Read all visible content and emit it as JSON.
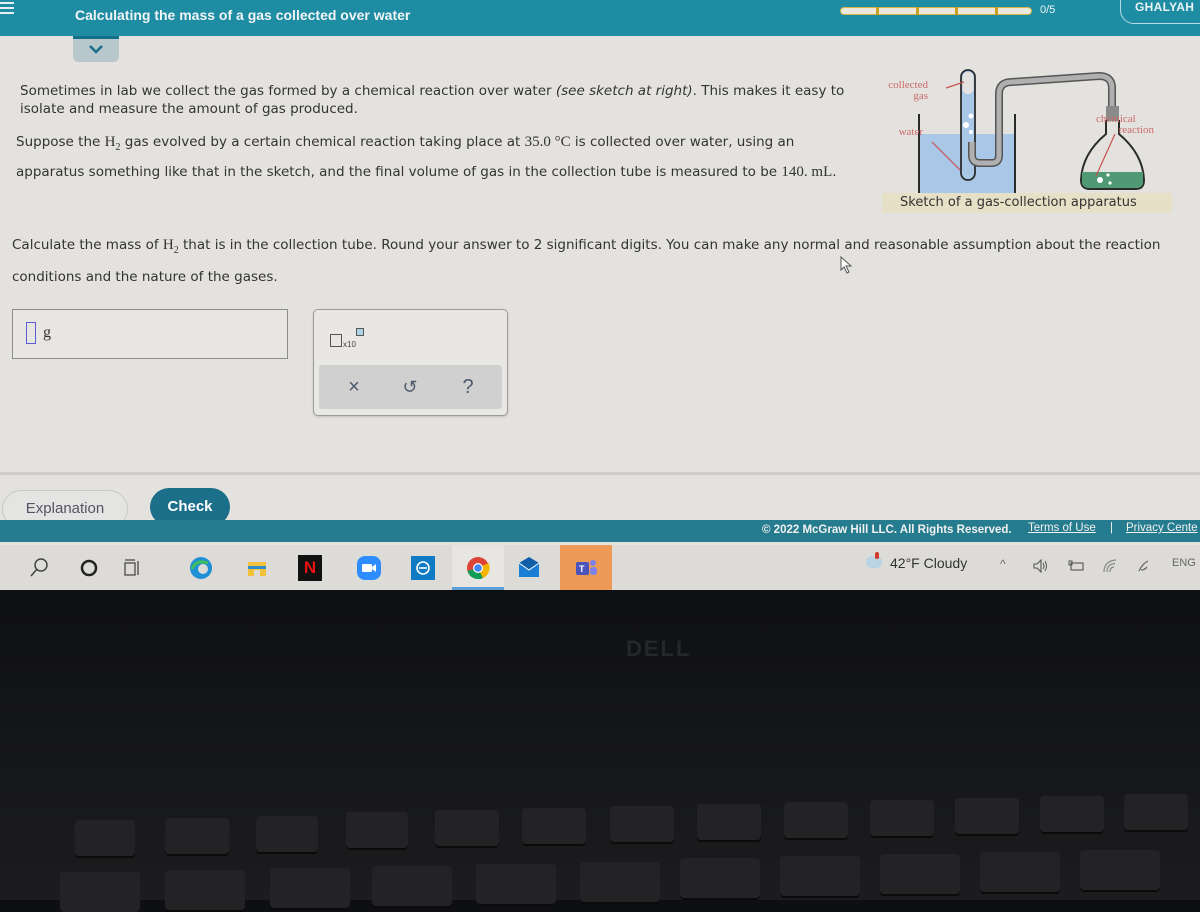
{
  "header": {
    "menu_icon": "hamburger-menu-icon",
    "title": "Calculating the mass of a gas collected over water",
    "progress": {
      "completed": 0,
      "total": 5,
      "label": "0/5"
    },
    "user_name": "GHALYAH",
    "collapse_icon": "chevron-down-icon"
  },
  "problem": {
    "p1_a": "Sometimes in lab we collect the gas formed by a chemical reaction over water ",
    "p1_italic": "(see sketch at right)",
    "p1_b": ". This makes it easy to isolate and measure the amount of gas produced.",
    "p2_a": "Suppose the ",
    "gas_symbol": "H",
    "gas_subscript": "2",
    "p2_b": " gas evolved by a certain chemical reaction taking place at ",
    "temperature": "35.0 °C",
    "p2_c": " is collected over water, using an apparatus something like that in the sketch, and the final volume of gas in the collection tube is measured to be ",
    "volume": "140. mL",
    "p2_d": ".",
    "p3_a": "Calculate the mass of ",
    "p3_b": " that is in the collection tube. Round your answer to 2 significant digits. You can make any normal and reasonable assumption about the reaction conditions and the nature of the gases."
  },
  "figure": {
    "labels": {
      "collected_gas": [
        "collected",
        "gas"
      ],
      "water": "water",
      "chemical_reaction": [
        "chemical",
        "reaction"
      ]
    },
    "caption": "Sketch of a gas-collection apparatus",
    "colors": {
      "water": "#a9c8e8",
      "reaction": "#4f9a74",
      "tube": "#a8a8a8",
      "label": "#c96a6a"
    }
  },
  "answer": {
    "value": "",
    "unit": "g"
  },
  "tools": {
    "sci_notation_label": "x10",
    "clear_icon": "×",
    "undo_icon": "↺",
    "help_icon": "?"
  },
  "buttons": {
    "explanation": "Explanation",
    "check": "Check"
  },
  "footer": {
    "copyright": "© 2022 McGraw Hill LLC. All Rights Reserved.",
    "terms": "Terms of Use",
    "separator": "|",
    "privacy": "Privacy Cente"
  },
  "taskbar": {
    "apps": [
      "search-icon",
      "cortana-icon",
      "task-view-icon",
      "edge-icon",
      "file-explorer-icon",
      "netflix-icon",
      "zoom-icon",
      "app-icon",
      "chrome-icon",
      "mail-icon",
      "teams-icon"
    ],
    "netflix_letter": "N",
    "weather": "42°F  Cloudy",
    "tray": {
      "chevron": "^",
      "language": "ENG"
    }
  },
  "bezel": {
    "brand": "DELL"
  },
  "colors": {
    "header": "#1e8ca3",
    "check_button": "#1b6f88",
    "footer": "#267c8f",
    "page_bg": "#e4e2de"
  }
}
